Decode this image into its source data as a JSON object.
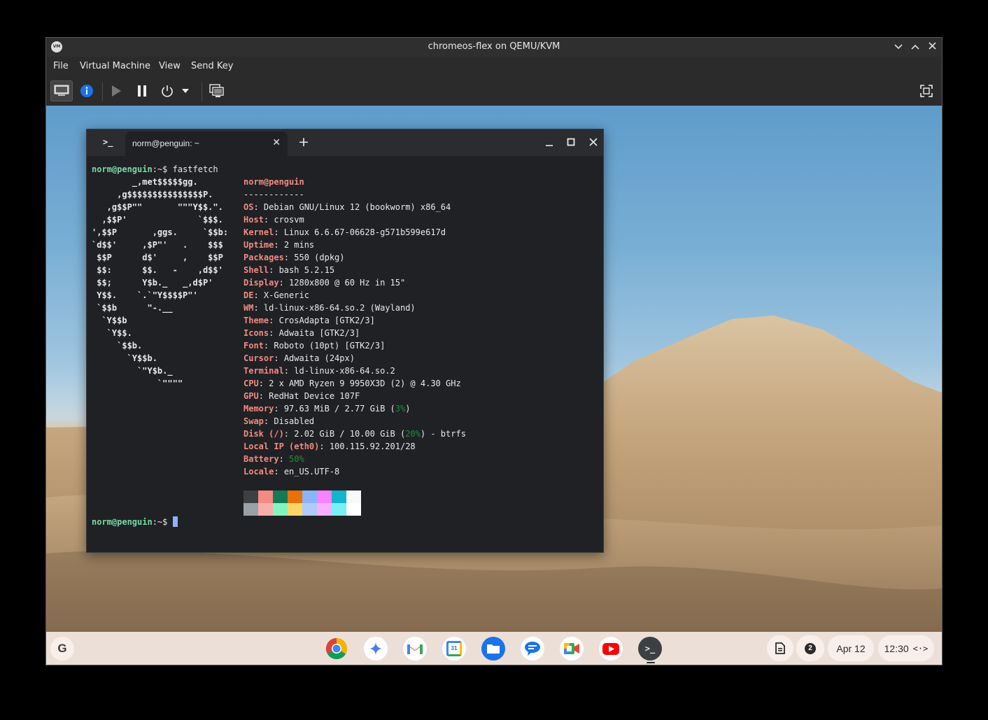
{
  "window": {
    "title": "chromeos-flex on QEMU/KVM",
    "app_icon": "vmm-icon"
  },
  "menu": [
    "File",
    "Virtual Machine",
    "View",
    "Send Key"
  ],
  "toolbar": [
    "display-console-icon",
    "info-icon",
    "run-icon",
    "pause-icon",
    "power-icon",
    "dropdown-icon",
    "snapshot-icon",
    "fullscreen-icon"
  ],
  "terminal": {
    "tab_label": "norm@penguin: ~",
    "prompt_user": "norm@penguin",
    "prompt_suffix": ":~$",
    "command": " fastfetch",
    "ascii_art": [
      "        _,met$$$$$gg.",
      "     ,g$$$$$$$$$$$$$$$P.",
      "   ,g$$P\"\"       \"\"\"Y$$.\".",
      "  ,$$P'              `$$$.",
      "',$$P       ,ggs.     `$$b:",
      "`d$$'     ,$P\"'   .    $$$",
      " $$P      d$'     ,    $$P",
      " $$:      $$.   -    ,d$$'",
      " $$;      Y$b._   _,d$P'",
      " Y$$.    `.`\"Y$$$$P\"'",
      " `$$b      \"-.__",
      "  `Y$$b",
      "   `Y$$.",
      "     `$$b.",
      "       `Y$$b.",
      "         `\"Y$b._",
      "             `\"\"\"\""
    ],
    "header_title": "norm@penguin",
    "header_rule": "------------",
    "info": [
      {
        "key": "OS",
        "value": "Debian GNU/Linux 12 (bookworm) x86_64"
      },
      {
        "key": "Host",
        "value": "crosvm"
      },
      {
        "key": "Kernel",
        "value": "Linux 6.6.67-06628-g571b599e617d"
      },
      {
        "key": "Uptime",
        "value": "2 mins"
      },
      {
        "key": "Packages",
        "value": "550 (dpkg)"
      },
      {
        "key": "Shell",
        "value": "bash 5.2.15"
      },
      {
        "key": "Display",
        "value": "1280x800 @ 60 Hz in 15\""
      },
      {
        "key": "DE",
        "value": "X-Generic"
      },
      {
        "key": "WM",
        "value": "ld-linux-x86-64.so.2 (Wayland)"
      },
      {
        "key": "Theme",
        "value": "CrosAdapta [GTK2/3]"
      },
      {
        "key": "Icons",
        "value": "Adwaita [GTK2/3]"
      },
      {
        "key": "Font",
        "value": "Roboto (10pt) [GTK2/3]"
      },
      {
        "key": "Cursor",
        "value": "Adwaita (24px)"
      },
      {
        "key": "Terminal",
        "value": "ld-linux-x86-64.so.2"
      },
      {
        "key": "CPU",
        "value": "2 x AMD Ryzen 9 9950X3D (2) @ 4.30 GHz"
      },
      {
        "key": "GPU",
        "value": "RedHat Device 107F"
      },
      {
        "key": "Memory",
        "value": "97.63 MiB / 2.77 GiB (",
        "pct": "3%",
        "tail": ")"
      },
      {
        "key": "Swap",
        "value": "Disabled"
      },
      {
        "key": "Disk (/)",
        "value": "2.02 GiB / 10.00 GiB (",
        "pct": "20%",
        "tail": ") - btrfs"
      },
      {
        "key": "Local IP (eth0)",
        "value": "100.115.92.201/28"
      },
      {
        "key": "Battery",
        "value": "",
        "pct": "50%",
        "tail": ""
      },
      {
        "key": "Locale",
        "value": "en_US.UTF-8"
      }
    ],
    "palette_top": [
      "#3c4043",
      "#f28b82",
      "#137a55",
      "#e8710a",
      "#8ab4f8",
      "#f882ff",
      "#12b5cb",
      "#f8f9fa"
    ],
    "palette_bottom": [
      "#9aa0a6",
      "#f6aea9",
      "#81f5c0",
      "#fdd663",
      "#aecbfa",
      "#f9aeff",
      "#78f0f5",
      "#ffffff"
    ]
  },
  "shelf": {
    "launcher": "G",
    "apps": [
      "chrome-icon",
      "gemini-icon",
      "gmail-icon",
      "calendar-icon",
      "files-icon",
      "messages-icon",
      "meet-icon",
      "youtube-icon",
      "terminal-icon"
    ],
    "calendar_day": "31",
    "notification_count": "2",
    "date": "Apr 12",
    "time": "12:30"
  }
}
